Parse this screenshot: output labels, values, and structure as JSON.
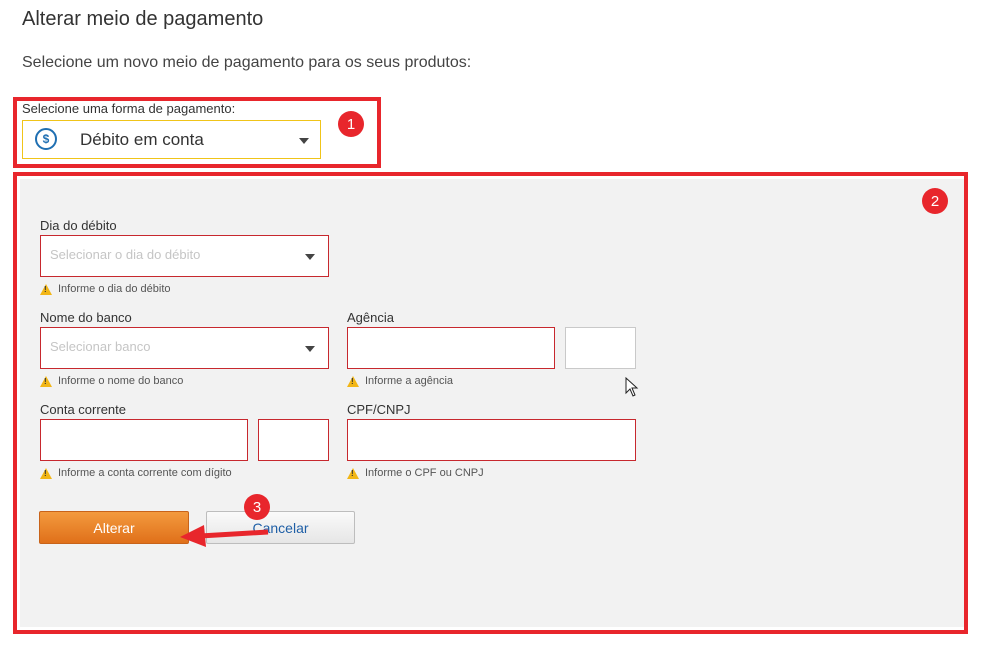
{
  "header": {
    "title": "Alterar meio de pagamento",
    "subtitle": "Selecione um novo meio de pagamento para os seus produtos:"
  },
  "payment": {
    "label": "Selecione uma forma de pagamento:",
    "selected": "Débito em conta",
    "icon": "dollar-circle-icon"
  },
  "form": {
    "dia": {
      "label": "Dia do débito",
      "placeholder": "Selecionar o dia do débito",
      "warning": "Informe o dia do débito"
    },
    "banco": {
      "label": "Nome do banco",
      "placeholder": "Selecionar banco",
      "warning": "Informe o nome do banco"
    },
    "agencia": {
      "label": "Agência",
      "value": "",
      "digit_value": "",
      "warning": "Informe a agência"
    },
    "conta": {
      "label": "Conta corrente",
      "value": "",
      "digit_value": "",
      "warning": "Informe a conta corrente com dígito"
    },
    "cpf": {
      "label": "CPF/CNPJ",
      "value": "",
      "warning": "Informe o CPF ou CNPJ"
    }
  },
  "buttons": {
    "submit": "Alterar",
    "cancel": "Cancelar"
  },
  "annotations": {
    "badge1": "1",
    "badge2": "2",
    "badge3": "3",
    "color": "#e8262c"
  },
  "colors": {
    "primary_button": "#e97e27",
    "error_border": "#c7282e",
    "warning_icon": "#f2b616",
    "highlight_border": "#f0c419"
  }
}
